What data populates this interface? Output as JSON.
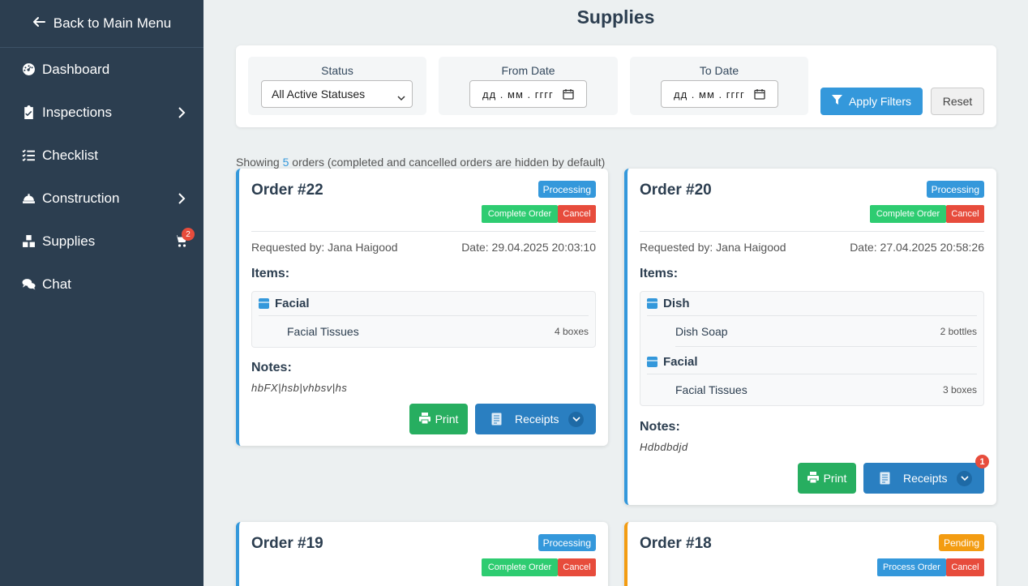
{
  "sidebar": {
    "back_label": "Back to Main Menu",
    "items": [
      {
        "label": "Dashboard",
        "icon": "dashboard-icon"
      },
      {
        "label": "Inspections",
        "icon": "clipboard-check-icon"
      },
      {
        "label": "Checklist",
        "icon": "list-check-icon"
      },
      {
        "label": "Construction",
        "icon": "hard-hat-icon"
      },
      {
        "label": "Supplies",
        "icon": "boxes-icon",
        "cart_badge": "2"
      },
      {
        "label": "Chat",
        "icon": "comments-icon"
      }
    ]
  },
  "page": {
    "title": "Supplies"
  },
  "filters": {
    "status_label": "Status",
    "status_value": "All Active Statuses",
    "from_label": "From Date",
    "from_placeholder": "дд . мм . гггг",
    "to_label": "To Date",
    "to_placeholder": "дд . мм . гггг",
    "apply_label": "Apply Filters",
    "reset_label": "Reset"
  },
  "summary": {
    "prefix": "Showing ",
    "count": "5",
    "suffix": " orders (completed and cancelled orders are hidden by default)"
  },
  "orders": [
    {
      "title": "Order #22",
      "status": "Processing",
      "primary_action": "Complete Order",
      "cancel": "Cancel",
      "requested_by": "Requested by: Jana Haigood",
      "date": "Date: 29.04.2025 20:03:10",
      "items_label": "Items:",
      "categories": [
        {
          "name": "Facial",
          "items": [
            {
              "name": "Facial Tissues",
              "qty": "4 boxes"
            }
          ]
        }
      ],
      "notes_label": "Notes:",
      "notes": "hbFX|hsb|vhbsv|hs",
      "print_label": "Print",
      "receipts_label": "Receipts"
    },
    {
      "title": "Order #20",
      "status": "Processing",
      "primary_action": "Complete Order",
      "cancel": "Cancel",
      "requested_by": "Requested by: Jana Haigood",
      "date": "Date: 27.04.2025 20:58:26",
      "items_label": "Items:",
      "categories": [
        {
          "name": "Dish",
          "items": [
            {
              "name": "Dish Soap",
              "qty": "2 bottles"
            }
          ]
        },
        {
          "name": "Facial",
          "items": [
            {
              "name": "Facial Tissues",
              "qty": "3 boxes"
            }
          ]
        }
      ],
      "notes_label": "Notes:",
      "notes": "Hdbdbdjd",
      "print_label": "Print",
      "receipts_label": "Receipts",
      "receipts_badge": "1"
    },
    {
      "title": "Order #19",
      "status": "Processing",
      "primary_action": "Complete Order",
      "cancel": "Cancel"
    },
    {
      "title": "Order #18",
      "status": "Pending",
      "primary_action": "Process Order",
      "cancel": "Cancel"
    }
  ],
  "colors": {
    "sidebar": "#2c3e50",
    "accent": "#3498db",
    "success": "#27ae60",
    "danger": "#e74c3c",
    "pending": "#f39c12"
  }
}
